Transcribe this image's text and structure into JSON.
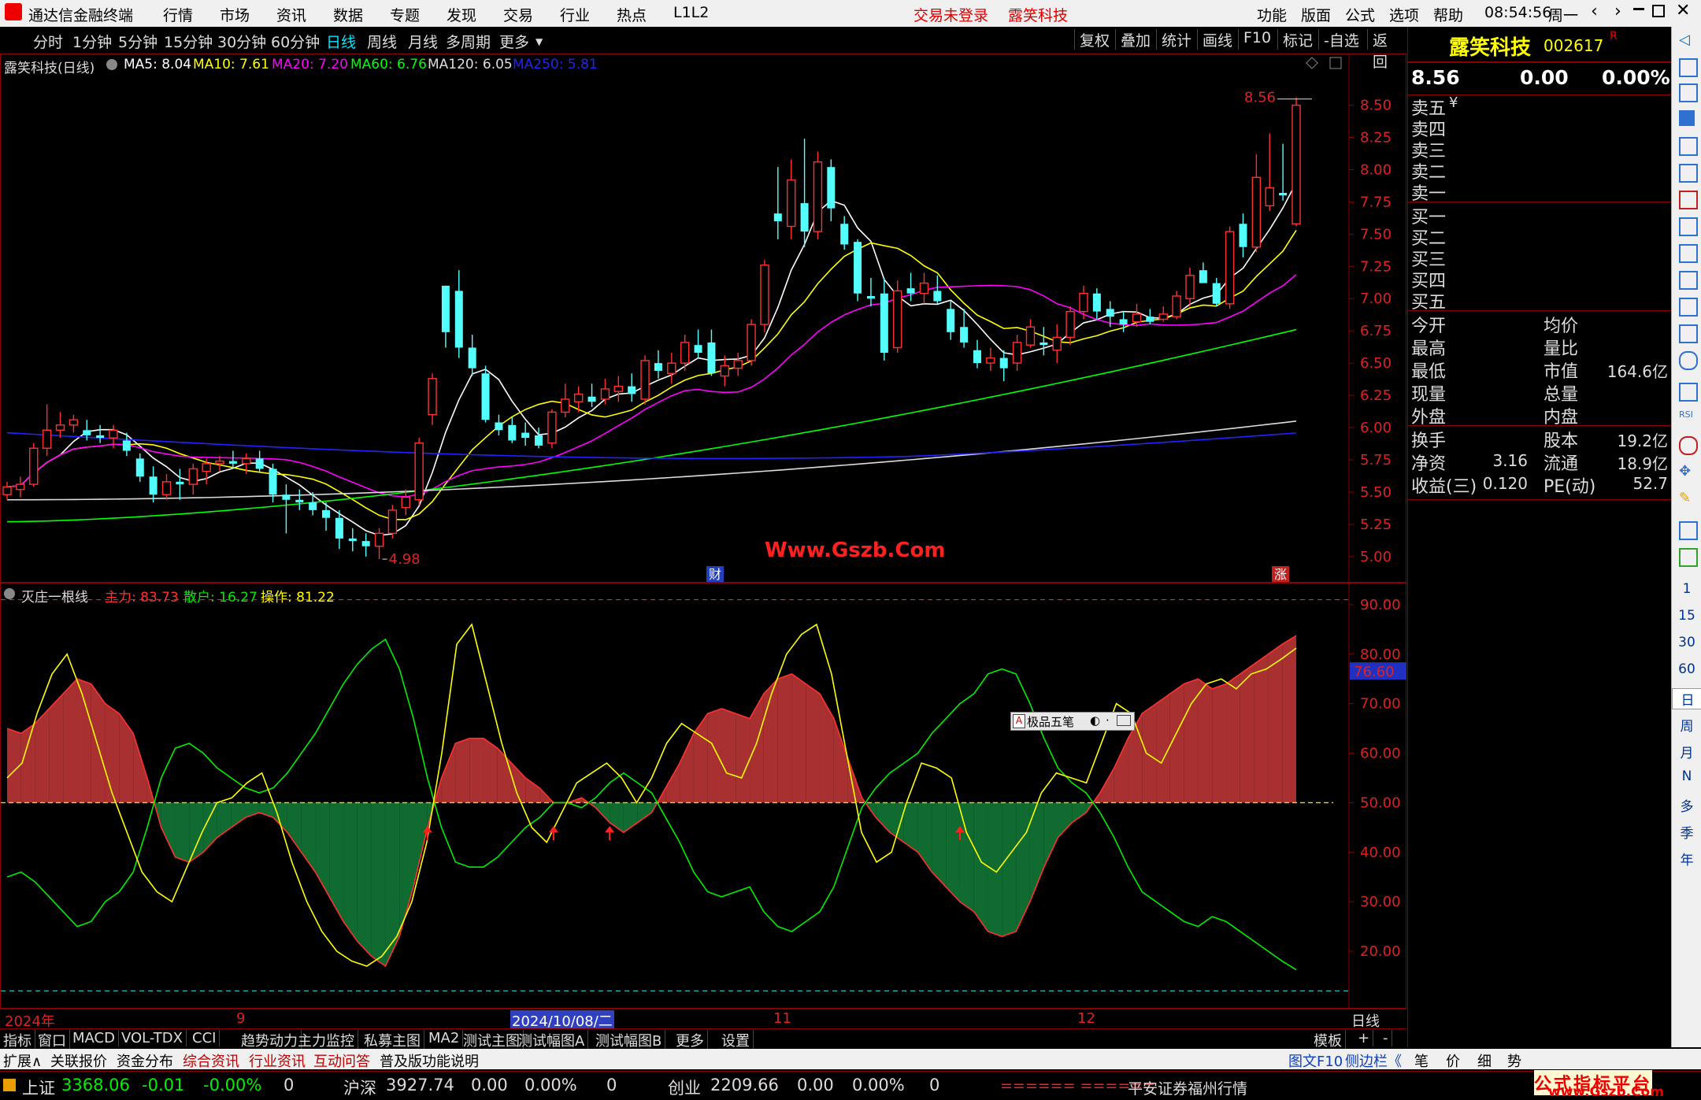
{
  "menubar": {
    "app_title": "通达信金融终端",
    "items": [
      "行情",
      "市场",
      "资讯",
      "数据",
      "专题",
      "发现",
      "交易",
      "行业",
      "热点",
      "L1L2"
    ],
    "trade_status": "交易未登录",
    "stock_name": "露笑科技",
    "right_items": [
      "功能",
      "版面",
      "公式",
      "选项",
      "帮助"
    ],
    "clock": "08:54:56",
    "weekday": "周一"
  },
  "periods": {
    "tabs": [
      "分时",
      "1分钟",
      "5分钟",
      "15分钟",
      "30分钟",
      "60分钟",
      "日线",
      "周线",
      "月线",
      "多周期",
      "更多"
    ],
    "active": "日线",
    "tools": [
      "复权",
      "叠加",
      "统计",
      "画线",
      "F10",
      "标记",
      "-自选",
      "返回"
    ]
  },
  "main_chart": {
    "title": "露笑科技(日线)",
    "ma_legend": [
      {
        "label": "MA5: 8.04",
        "color": "#ffffff"
      },
      {
        "label": "MA10: 7.61",
        "color": "#ffff00"
      },
      {
        "label": "MA20: 7.20",
        "color": "#ff00ff"
      },
      {
        "label": "MA60: 6.76",
        "color": "#00ff00"
      },
      {
        "label": "MA120: 6.05",
        "color": "#dddddd"
      },
      {
        "label": "MA250: 5.81",
        "color": "#2222ff"
      }
    ],
    "y_ticks": [
      "8.50",
      "8.25",
      "8.00",
      "7.75",
      "7.50",
      "7.25",
      "7.00",
      "6.75",
      "6.50",
      "6.25",
      "6.00",
      "5.75",
      "5.50",
      "5.25",
      "5.00"
    ],
    "high_label": "8.56",
    "low_label": "4.98",
    "watermark": "Www.Gszb.Com",
    "marker_cai": "财",
    "marker_zhang": "涨"
  },
  "chart_data": {
    "type": "candlestick",
    "y_range": [
      4.95,
      8.65
    ],
    "candles": [
      [
        5.48,
        5.58,
        5.44,
        5.54
      ],
      [
        5.52,
        5.62,
        5.46,
        5.56
      ],
      [
        5.56,
        5.88,
        5.54,
        5.84
      ],
      [
        5.84,
        6.18,
        5.78,
        5.98
      ],
      [
        5.98,
        6.12,
        5.92,
        6.02
      ],
      [
        6.02,
        6.1,
        5.96,
        6.06
      ],
      [
        5.98,
        6.06,
        5.9,
        5.94
      ],
      [
        5.94,
        6.02,
        5.88,
        5.92
      ],
      [
        5.92,
        6.02,
        5.84,
        5.98
      ],
      [
        5.9,
        5.96,
        5.78,
        5.82
      ],
      [
        5.76,
        5.8,
        5.58,
        5.62
      ],
      [
        5.62,
        5.7,
        5.42,
        5.48
      ],
      [
        5.48,
        5.64,
        5.44,
        5.58
      ],
      [
        5.58,
        5.68,
        5.44,
        5.56
      ],
      [
        5.56,
        5.72,
        5.48,
        5.68
      ],
      [
        5.66,
        5.76,
        5.56,
        5.72
      ],
      [
        5.72,
        5.78,
        5.66,
        5.74
      ],
      [
        5.74,
        5.82,
        5.68,
        5.72
      ],
      [
        5.72,
        5.8,
        5.64,
        5.76
      ],
      [
        5.76,
        5.82,
        5.66,
        5.68
      ],
      [
        5.68,
        5.72,
        5.42,
        5.48
      ],
      [
        5.48,
        5.56,
        5.18,
        5.44
      ],
      [
        5.44,
        5.52,
        5.36,
        5.42
      ],
      [
        5.42,
        5.5,
        5.32,
        5.36
      ],
      [
        5.36,
        5.42,
        5.2,
        5.3
      ],
      [
        5.3,
        5.36,
        5.06,
        5.14
      ],
      [
        5.14,
        5.22,
        5.04,
        5.12
      ],
      [
        5.12,
        5.18,
        5.0,
        5.08
      ],
      [
        5.08,
        5.22,
        4.98,
        5.18
      ],
      [
        5.18,
        5.4,
        5.14,
        5.36
      ],
      [
        5.38,
        5.52,
        5.32,
        5.46
      ],
      [
        5.44,
        5.92,
        5.4,
        5.88
      ],
      [
        6.1,
        6.42,
        6.02,
        6.38
      ],
      [
        7.1,
        7.1,
        6.62,
        6.74
      ],
      [
        7.06,
        7.22,
        6.54,
        6.62
      ],
      [
        6.62,
        6.72,
        6.4,
        6.46
      ],
      [
        6.42,
        6.48,
        6.04,
        6.06
      ],
      [
        6.04,
        6.1,
        5.94,
        5.98
      ],
      [
        6.02,
        6.08,
        5.88,
        5.9
      ],
      [
        5.96,
        6.04,
        5.86,
        5.92
      ],
      [
        5.94,
        6.0,
        5.84,
        5.86
      ],
      [
        5.88,
        6.14,
        5.84,
        6.12
      ],
      [
        6.12,
        6.34,
        6.08,
        6.22
      ],
      [
        6.2,
        6.32,
        6.12,
        6.26
      ],
      [
        6.24,
        6.34,
        6.16,
        6.2
      ],
      [
        6.22,
        6.38,
        6.18,
        6.3
      ],
      [
        6.28,
        6.4,
        6.2,
        6.32
      ],
      [
        6.32,
        6.42,
        6.2,
        6.26
      ],
      [
        6.22,
        6.56,
        6.18,
        6.52
      ],
      [
        6.5,
        6.6,
        6.38,
        6.44
      ],
      [
        6.42,
        6.58,
        6.34,
        6.5
      ],
      [
        6.5,
        6.72,
        6.44,
        6.66
      ],
      [
        6.64,
        6.76,
        6.54,
        6.58
      ],
      [
        6.66,
        6.76,
        6.4,
        6.42
      ],
      [
        6.4,
        6.56,
        6.32,
        6.48
      ],
      [
        6.46,
        6.58,
        6.4,
        6.52
      ],
      [
        6.52,
        6.84,
        6.48,
        6.8
      ],
      [
        6.8,
        7.3,
        6.74,
        7.26
      ],
      [
        7.66,
        8.02,
        7.46,
        7.6
      ],
      [
        7.56,
        8.08,
        7.46,
        7.92
      ],
      [
        7.74,
        8.24,
        7.4,
        7.52
      ],
      [
        7.52,
        8.14,
        7.46,
        8.06
      ],
      [
        8.02,
        8.08,
        7.6,
        7.7
      ],
      [
        7.58,
        7.64,
        7.38,
        7.42
      ],
      [
        7.44,
        7.46,
        6.98,
        7.04
      ],
      [
        7.02,
        7.16,
        6.94,
        7.0
      ],
      [
        7.04,
        7.16,
        6.52,
        6.58
      ],
      [
        6.62,
        7.14,
        6.58,
        7.06
      ],
      [
        7.08,
        7.2,
        6.98,
        7.04
      ],
      [
        7.04,
        7.2,
        6.96,
        7.12
      ],
      [
        7.06,
        7.18,
        6.96,
        6.98
      ],
      [
        6.92,
        6.98,
        6.68,
        6.74
      ],
      [
        6.78,
        6.92,
        6.62,
        6.66
      ],
      [
        6.6,
        6.68,
        6.46,
        6.5
      ],
      [
        6.5,
        6.62,
        6.44,
        6.54
      ],
      [
        6.54,
        6.6,
        6.36,
        6.46
      ],
      [
        6.5,
        6.72,
        6.44,
        6.66
      ],
      [
        6.64,
        6.84,
        6.62,
        6.78
      ],
      [
        6.66,
        6.78,
        6.56,
        6.64
      ],
      [
        6.6,
        6.8,
        6.5,
        6.7
      ],
      [
        6.7,
        6.94,
        6.64,
        6.9
      ],
      [
        6.9,
        7.1,
        6.84,
        7.04
      ],
      [
        7.04,
        7.08,
        6.84,
        6.9
      ],
      [
        6.92,
        6.98,
        6.78,
        6.86
      ],
      [
        6.84,
        6.9,
        6.74,
        6.8
      ],
      [
        6.82,
        6.96,
        6.78,
        6.88
      ],
      [
        6.86,
        6.92,
        6.8,
        6.82
      ],
      [
        6.84,
        6.94,
        6.82,
        6.88
      ],
      [
        6.86,
        7.06,
        6.84,
        7.02
      ],
      [
        7.0,
        7.24,
        6.94,
        7.18
      ],
      [
        7.22,
        7.28,
        7.16,
        7.12
      ],
      [
        7.12,
        7.16,
        6.94,
        6.96
      ],
      [
        6.96,
        7.56,
        6.92,
        7.52
      ],
      [
        7.58,
        7.66,
        7.32,
        7.4
      ],
      [
        7.4,
        8.12,
        7.36,
        7.94
      ],
      [
        7.72,
        8.28,
        7.68,
        7.86
      ],
      [
        7.82,
        8.2,
        7.76,
        7.8
      ],
      [
        7.58,
        8.56,
        7.56,
        8.5
      ]
    ],
    "indicator": {
      "name": "灭庄一根线",
      "series": [
        {
          "name": "主力",
          "value": "83.73"
        },
        {
          "name": "散户",
          "value": "16.27"
        },
        {
          "name": "操作",
          "value": "81.22"
        }
      ],
      "y_range": [
        10,
        93
      ],
      "ticks": [
        "90.00",
        "80.00",
        "70.00",
        "60.00",
        "50.00",
        "40.00",
        "30.00",
        "20.00"
      ],
      "cursor_value": "76.60",
      "main_force": [
        65,
        64,
        66,
        69,
        72,
        75,
        74,
        70,
        68,
        64,
        55,
        45,
        39,
        38,
        40,
        43,
        45,
        47,
        48,
        47,
        44,
        40,
        36,
        31,
        26,
        22,
        19,
        17,
        23,
        33,
        45,
        55,
        62,
        63,
        63,
        61,
        58,
        55,
        53,
        50,
        50,
        51,
        49,
        46,
        44,
        46,
        48,
        53,
        58,
        64,
        68,
        69,
        68,
        67,
        72,
        75,
        76,
        74,
        72,
        67,
        59,
        51,
        47,
        44,
        42,
        40,
        36,
        33,
        30,
        28,
        24,
        23,
        24,
        30,
        37,
        43,
        46,
        48,
        52,
        57,
        63,
        68,
        70,
        72,
        74,
        75,
        73,
        74,
        76,
        78,
        80,
        82,
        83.73
      ],
      "retail": [
        35,
        36,
        34,
        31,
        28,
        25,
        26,
        30,
        32,
        36,
        45,
        55,
        61,
        62,
        60,
        57,
        55,
        53,
        52,
        53,
        56,
        60,
        64,
        69,
        74,
        78,
        81,
        83,
        77,
        67,
        55,
        45,
        38,
        37,
        37,
        39,
        42,
        45,
        47,
        50,
        50,
        49,
        51,
        54,
        56,
        54,
        52,
        47,
        42,
        36,
        32,
        31,
        32,
        33,
        28,
        25,
        24,
        26,
        28,
        33,
        41,
        49,
        53,
        56,
        58,
        60,
        64,
        67,
        70,
        72,
        76,
        77,
        76,
        70,
        63,
        57,
        54,
        52,
        48,
        43,
        37,
        32,
        30,
        28,
        26,
        25,
        27,
        26,
        24,
        22,
        20,
        18,
        16.27
      ],
      "operate": [
        55,
        58,
        68,
        76,
        80,
        72,
        62,
        52,
        44,
        36,
        32,
        30,
        37,
        44,
        50,
        51,
        54,
        56,
        48,
        38,
        30,
        24,
        20,
        18,
        17,
        19,
        23,
        30,
        42,
        60,
        82,
        86,
        74,
        62,
        52,
        45,
        42,
        48,
        54,
        56,
        58,
        55,
        50,
        55,
        62,
        66,
        64,
        62,
        56,
        55,
        62,
        72,
        80,
        84,
        86,
        76,
        60,
        44,
        38,
        40,
        50,
        58,
        57,
        55,
        44,
        38,
        36,
        40,
        44,
        52,
        56,
        55,
        54,
        62,
        70,
        68,
        60,
        58,
        64,
        70,
        74,
        75,
        73,
        76,
        77,
        79,
        81.22
      ]
    },
    "arrows_at": [
      30,
      39,
      43,
      68
    ]
  },
  "floating_widget": {
    "label": "极品五笔"
  },
  "date_axis": {
    "labels": [
      "2024年",
      "9",
      "2024/10/08/二",
      "11",
      "12"
    ],
    "right": "日线"
  },
  "right_panel": {
    "name": "露笑科技",
    "code": "002617",
    "code_flag": "R",
    "price": "8.56",
    "change": "0.00",
    "change_pct": "0.00%",
    "sell": [
      "卖五",
      "卖四",
      "卖三",
      "卖二",
      "卖一"
    ],
    "sell_suffix": "¥",
    "buy": [
      "买一",
      "买二",
      "买三",
      "买四",
      "买五"
    ],
    "stats_left": [
      "今开",
      "最高",
      "最低",
      "现量",
      "外盘"
    ],
    "stats_right": [
      "均价",
      "量比",
      "市值",
      "总量",
      "内盘"
    ],
    "market_cap": "164.6亿",
    "fin": [
      {
        "l": "换手",
        "lv": "",
        "r": "股本",
        "rv": "19.2亿"
      },
      {
        "l": "净资",
        "lv": "3.16",
        "r": "流通",
        "rv": "18.9亿"
      },
      {
        "l": "收益(三)",
        "lv": "0.120",
        "r": "PE(动)",
        "rv": "52.7"
      }
    ]
  },
  "side_letters": [
    "1",
    "15",
    "30",
    "60",
    "日",
    "周",
    "月",
    "N",
    "多",
    "季",
    "年"
  ],
  "indicator_tabs": [
    "指标",
    "窗口",
    "MACD",
    "VOL-TDX",
    "CCI",
    "趋势动力",
    "主力监控",
    "私募主图",
    "MA2",
    "测试主图",
    "测试幅图A",
    "测试幅图B",
    "更多",
    "设置"
  ],
  "indicator_tabs_right": [
    "模板",
    "+",
    "-"
  ],
  "bottom_tabs": [
    "扩展∧",
    "关联报价",
    "资金分布",
    "综合资讯",
    "行业资讯",
    "互动问答",
    "普及版功能说明"
  ],
  "bottom_right_tabs": [
    "图文F10",
    "侧边栏《",
    "笔",
    "价",
    "细",
    "势"
  ],
  "status": {
    "idx1_name": "上证",
    "idx1_val": "3368.06",
    "idx1_chg": "-0.01",
    "idx1_pct": "-0.00%",
    "idx1_vol": "0",
    "idx2_name": "沪深",
    "idx2_val": "3927.74",
    "idx2_chg": "0.00",
    "idx2_pct": "0.00%",
    "idx2_vol": "0",
    "idx3_name": "创业",
    "idx3_val": "2209.66",
    "idx3_chg": "0.00",
    "idx3_pct": "0.00%",
    "idx3_vol": "0",
    "bars": "====== ======",
    "broker": "平安证券福州行情",
    "watermark": "公式指标平台",
    "watermark_url": "www.Gszb.Com"
  }
}
